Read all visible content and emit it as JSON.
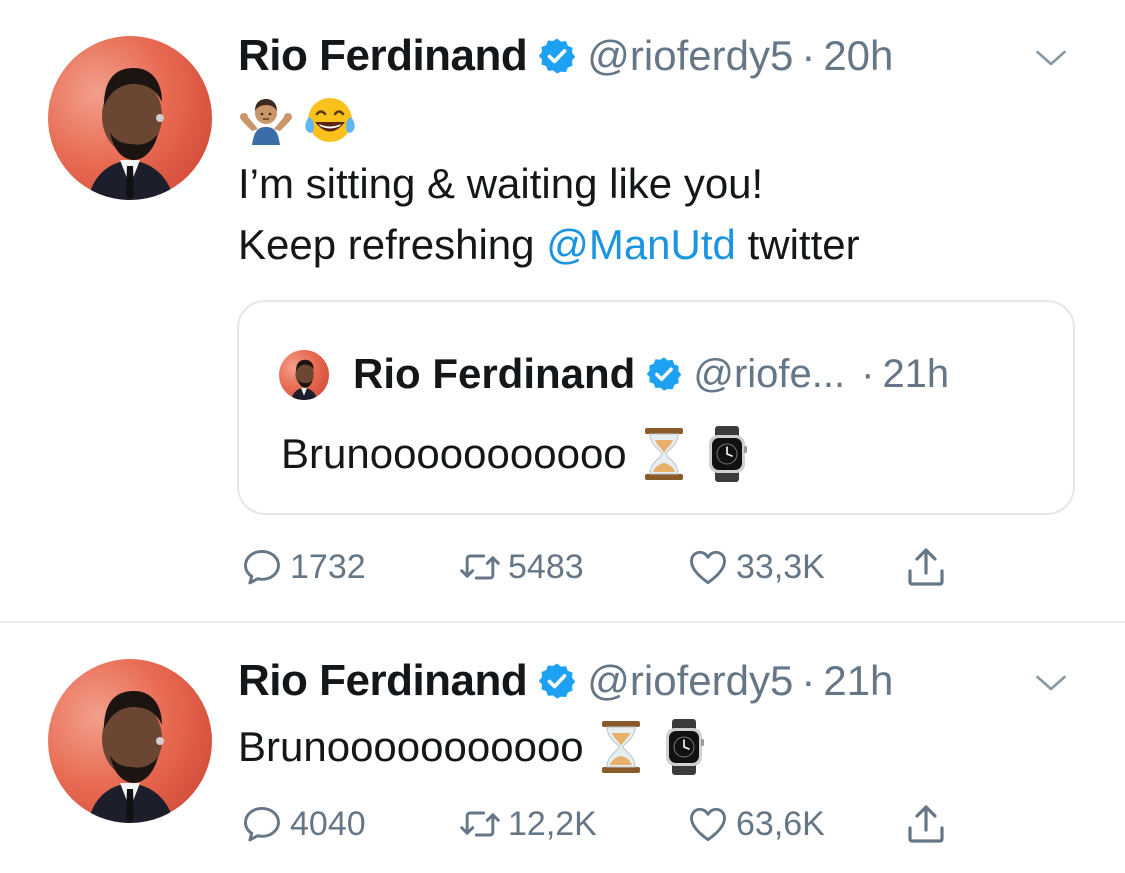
{
  "tweets": [
    {
      "author": "Rio Ferdinand",
      "handle": "@rioferdy5",
      "separator": "·",
      "time": "20h",
      "emoji_line": [
        "person-shrugging-emoji",
        "tears-of-joy-emoji"
      ],
      "text_line1": "I’m sitting & waiting like you!",
      "text_line2_prefix": "Keep refreshing ",
      "mention": "@ManUtd",
      "text_line2_suffix": " twitter",
      "quoted": {
        "author": "Rio Ferdinand",
        "handle": "@riofe...",
        "separator": "·",
        "time": "21h",
        "text": "Brunooooooooooo",
        "emojis": [
          "hourglass-emoji",
          "watch-emoji"
        ]
      },
      "stats": {
        "replies": "1732",
        "retweets": "5483",
        "likes": "33,3K"
      }
    },
    {
      "author": "Rio Ferdinand",
      "handle": "@rioferdy5",
      "separator": "·",
      "time": "21h",
      "text": "Brunooooooooooo",
      "emojis": [
        "hourglass-emoji",
        "watch-emoji"
      ],
      "stats": {
        "replies": "4040",
        "retweets": "12,2K",
        "likes": "63,6K"
      }
    }
  ],
  "colors": {
    "link": "#1b95e0",
    "verified": "#1da1f2",
    "secondary_text": "#657786",
    "border": "#e1e8ed"
  },
  "icons": [
    "verified-badge-icon",
    "caret-down-icon",
    "reply-icon",
    "retweet-icon",
    "like-icon",
    "share-icon"
  ]
}
